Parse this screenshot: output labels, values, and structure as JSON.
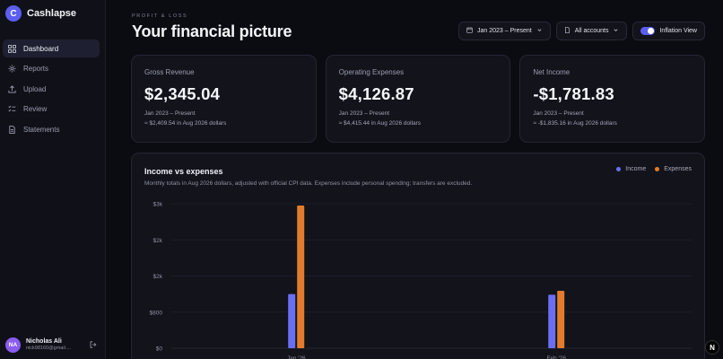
{
  "brand": {
    "logo_letter": "C",
    "name": "Cashlapse"
  },
  "sidebar": {
    "items": [
      {
        "label": "Dashboard",
        "icon": "grid-icon",
        "active": true
      },
      {
        "label": "Reports",
        "icon": "gear-icon",
        "active": false
      },
      {
        "label": "Upload",
        "icon": "upload-icon",
        "active": false
      },
      {
        "label": "Review",
        "icon": "checklist-icon",
        "active": false
      },
      {
        "label": "Statements",
        "icon": "document-icon",
        "active": false
      }
    ]
  },
  "user": {
    "initials": "NA",
    "name": "Nicholas Ali",
    "email": "nick98160@gmail...."
  },
  "header": {
    "eyebrow": "PROFIT & LOSS",
    "title": "Your financial picture",
    "date_filter": "Jan 2023 – Present",
    "account_filter": "All accounts",
    "inflation_label": "Inflation View",
    "inflation_on": true
  },
  "cards": [
    {
      "label": "Gross Revenue",
      "value": "$2,345.04",
      "period": "Jan 2023 – Present",
      "adjusted": "≈ $2,409.54 in Aug 2026 dollars"
    },
    {
      "label": "Operating Expenses",
      "value": "$4,126.87",
      "period": "Jan 2023 – Present",
      "adjusted": "≈ $4,415.44 in Aug 2026 dollars"
    },
    {
      "label": "Net Income",
      "value": "-$1,781.83",
      "period": "Jan 2023 – Present",
      "adjusted": "≈ -$1,835.16 in Aug 2026 dollars"
    }
  ],
  "chart": {
    "title": "Income vs expenses",
    "subtitle": "Monthly totals in Aug 2026 dollars, adjusted with official CPI data. Expenses include personal spending; transfers are excluded.",
    "legend": {
      "income": "Income",
      "expenses": "Expenses"
    }
  },
  "colors": {
    "income": "#6a6ff2",
    "expenses": "#e27c2c",
    "accent": "#5b5ef0"
  },
  "chart_data": {
    "type": "bar",
    "categories": [
      "Jan '26",
      "Feb '26"
    ],
    "series": [
      {
        "name": "Income",
        "values": [
          1500,
          1480
        ]
      },
      {
        "name": "Expenses",
        "values": [
          3950,
          1590
        ]
      }
    ],
    "ytick_labels": [
      "$0",
      "$800",
      "$2k",
      "$2k",
      "$3k"
    ],
    "ylim": [
      0,
      4000
    ],
    "grid": true,
    "legend_position": "top-right"
  },
  "fab": {
    "label": "N"
  }
}
